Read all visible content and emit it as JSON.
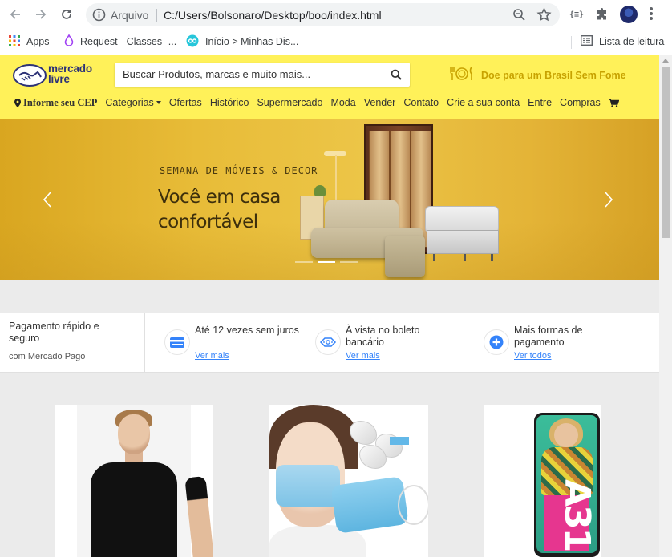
{
  "browser": {
    "omnibox_label": "Arquivo",
    "url": "C:/Users/Bolsonaro/Desktop/boo/index.html",
    "bookmarks": [
      {
        "label": "Apps",
        "icon": "apps-grid-icon"
      },
      {
        "label": "Request - Classes -...",
        "icon": "droplet-icon"
      },
      {
        "label": "Início > Minhas Dis...",
        "icon": "ring-icon"
      }
    ],
    "reading_list": "Lista de leitura"
  },
  "header": {
    "logo_line1": "mercado",
    "logo_line2": "livre",
    "search_placeholder": "Buscar Produtos, marcas e muito mais...",
    "promo": "Doe para um Brasil Sem Fome"
  },
  "nav": {
    "cep": "Informe seu CEP",
    "items": [
      "Categorias",
      "Ofertas",
      "Histórico",
      "Supermercado",
      "Moda",
      "Vender",
      "Contato",
      "Crie a sua conta",
      "Entre",
      "Compras"
    ]
  },
  "hero": {
    "kicker": "SEMANA DE MÓVEIS & DECOR",
    "title_line1": "Você em casa",
    "title_line2": "confortável",
    "slides_total": 3,
    "active_slide": 2
  },
  "payments": {
    "intro_title": "Pagamento rápido e seguro",
    "intro_sub": "com Mercado Pago",
    "items": [
      {
        "title": "Até 12 vezes sem juros",
        "link": "Ver mais",
        "icon": "credit-card-icon"
      },
      {
        "title": "À vista no boleto bancário",
        "link": "Ver mais",
        "icon": "cash-icon"
      },
      {
        "title": "Mais formas de pagamento",
        "link": "Ver todos",
        "icon": "plus-icon"
      }
    ]
  },
  "products": [
    {
      "image": "black-tshirt-man"
    },
    {
      "image": "face-masks"
    },
    {
      "image": "samsung-a31-phone",
      "phone_label": "A31"
    }
  ],
  "colors": {
    "header_yellow": "#fff159",
    "link_blue": "#3483fa",
    "logo_navy": "#2d3277"
  }
}
